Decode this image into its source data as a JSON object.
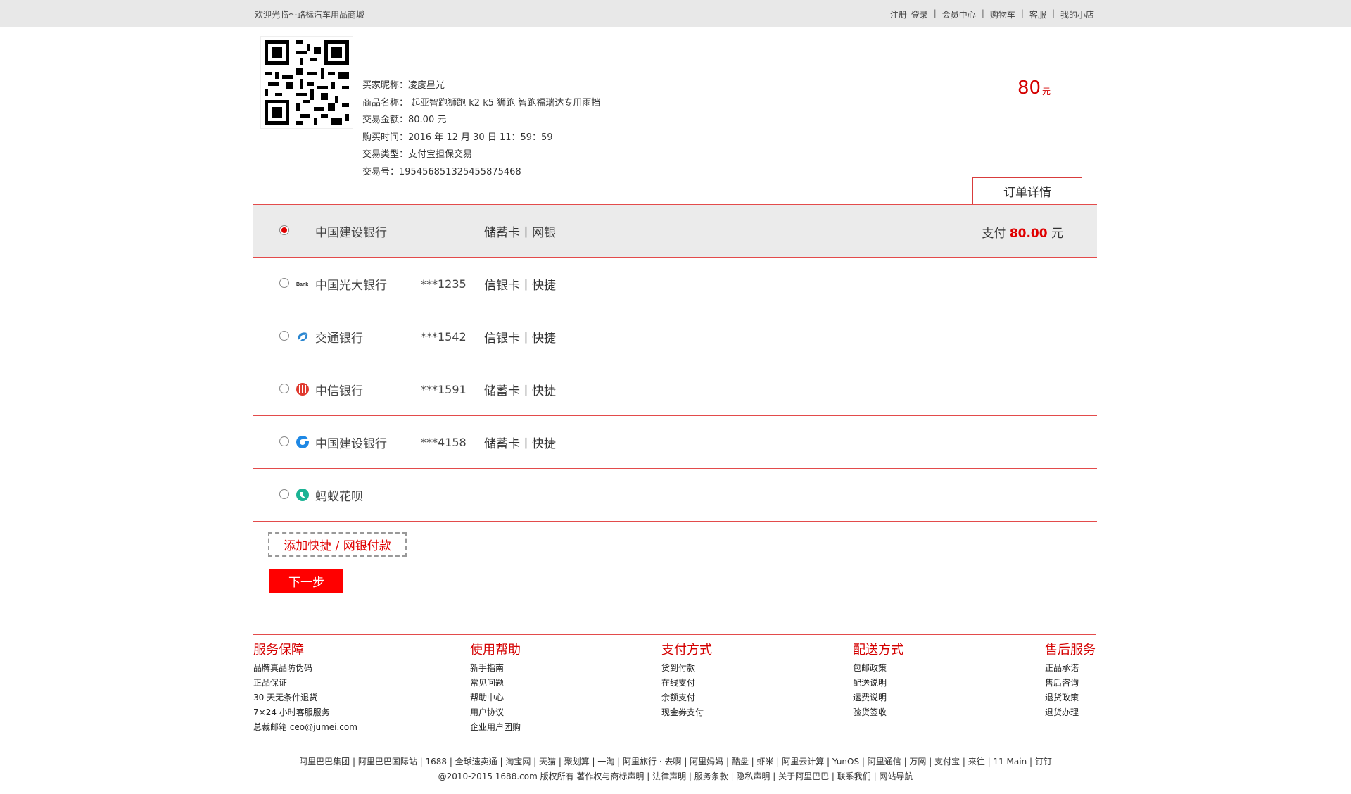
{
  "topbar": {
    "welcome": "欢迎光临～路标汽车用品商城",
    "links": [
      "注册",
      "登录",
      "会员中心",
      "购物车",
      "客服",
      "我的小店"
    ]
  },
  "order": {
    "buyer": "买家昵称：凌度星光",
    "product": "商品名称： 起亚智跑狮跑 k2 k5 狮跑 智跑福瑞达专用雨挡",
    "amount": "交易金额：80.00 元",
    "time": "购买时间：2016 年 12 月 30 日 11：59：59",
    "type": "交易类型：支付宝担保交易",
    "number": "交易号：195456851325455875468",
    "big_amount": "80",
    "big_unit": "元",
    "detail_button": "订单详情"
  },
  "banks": [
    {
      "name": "中国建设银行",
      "card": "",
      "type": "储蓄卡丨网银",
      "selected": true,
      "icon": "none",
      "pay_prefix": "支付",
      "pay_amount": "80.00",
      "pay_unit": "元"
    },
    {
      "name": "中国光大银行",
      "card": "***1235",
      "type": "信银卡丨快捷",
      "selected": false,
      "icon": "bank-text-icon"
    },
    {
      "name": "交通银行",
      "card": "***1542",
      "type": "信银卡丨快捷",
      "selected": false,
      "icon": "bocom-icon"
    },
    {
      "name": "中信银行",
      "card": "***1591",
      "type": "储蓄卡丨快捷",
      "selected": false,
      "icon": "citic-icon"
    },
    {
      "name": "中国建设银行",
      "card": "***4158",
      "type": "储蓄卡丨快捷",
      "selected": false,
      "icon": "ccb-icon"
    },
    {
      "name": "蚂蚁花呗",
      "card": "",
      "type": "",
      "selected": false,
      "icon": "huabei-icon"
    }
  ],
  "actions": {
    "add_payment": "添加快捷 / 网银付款",
    "next": "下一步"
  },
  "footer": {
    "columns": [
      {
        "title": "服务保障",
        "items": [
          "品牌真品防伪码",
          "正品保证",
          "30 天无条件退货",
          "7×24 小时客服服务",
          "总裁邮箱 ceo@jumei.com"
        ]
      },
      {
        "title": "使用帮助",
        "items": [
          "新手指南",
          "常见问题",
          "帮助中心",
          "用户协议",
          "企业用户团购"
        ]
      },
      {
        "title": "支付方式",
        "items": [
          "货到付款",
          "在线支付",
          "余额支付",
          "现金券支付"
        ]
      },
      {
        "title": "配送方式",
        "items": [
          "包邮政策",
          "配送说明",
          "运费说明",
          "验货签收"
        ]
      },
      {
        "title": "售后服务",
        "items": [
          "正品承诺",
          "售后咨询",
          "退货政策",
          "退货办理"
        ]
      }
    ],
    "links_line": "阿里巴巴集团 | 阿里巴巴国际站 | 1688 | 全球速卖通 | 淘宝网 | 天猫 | 聚划算 | 一淘 | 阿里旅行 · 去啊 | 阿里妈妈 | 酷盘 | 虾米 | 阿里云计算 | YunOS | 阿里通信 | 万网 | 支付宝 | 来往 | 11 Main | 钉钉",
    "copyright_line": "@2010-2015 1688.com 版权所有 著作权与商标声明 | 法律声明 | 服务条款 | 隐私声明 | 关于阿里巴巴 | 联系我们 | 网站导航"
  }
}
